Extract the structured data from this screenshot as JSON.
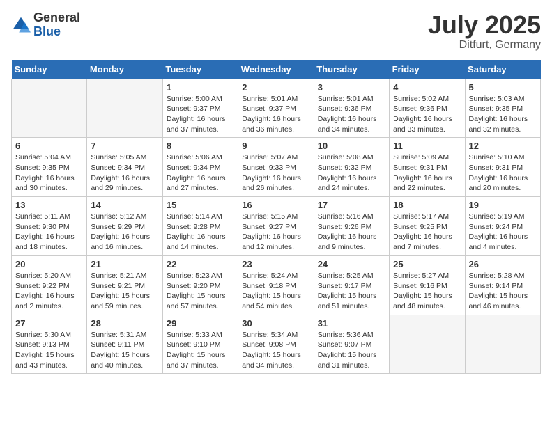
{
  "header": {
    "logo": {
      "general": "General",
      "blue": "Blue"
    },
    "title": "July 2025",
    "subtitle": "Ditfurt, Germany"
  },
  "calendar": {
    "weekdays": [
      "Sunday",
      "Monday",
      "Tuesday",
      "Wednesday",
      "Thursday",
      "Friday",
      "Saturday"
    ],
    "weeks": [
      [
        {
          "day": null,
          "info": null
        },
        {
          "day": null,
          "info": null
        },
        {
          "day": "1",
          "info": "Sunrise: 5:00 AM\nSunset: 9:37 PM\nDaylight: 16 hours\nand 37 minutes."
        },
        {
          "day": "2",
          "info": "Sunrise: 5:01 AM\nSunset: 9:37 PM\nDaylight: 16 hours\nand 36 minutes."
        },
        {
          "day": "3",
          "info": "Sunrise: 5:01 AM\nSunset: 9:36 PM\nDaylight: 16 hours\nand 34 minutes."
        },
        {
          "day": "4",
          "info": "Sunrise: 5:02 AM\nSunset: 9:36 PM\nDaylight: 16 hours\nand 33 minutes."
        },
        {
          "day": "5",
          "info": "Sunrise: 5:03 AM\nSunset: 9:35 PM\nDaylight: 16 hours\nand 32 minutes."
        }
      ],
      [
        {
          "day": "6",
          "info": "Sunrise: 5:04 AM\nSunset: 9:35 PM\nDaylight: 16 hours\nand 30 minutes."
        },
        {
          "day": "7",
          "info": "Sunrise: 5:05 AM\nSunset: 9:34 PM\nDaylight: 16 hours\nand 29 minutes."
        },
        {
          "day": "8",
          "info": "Sunrise: 5:06 AM\nSunset: 9:34 PM\nDaylight: 16 hours\nand 27 minutes."
        },
        {
          "day": "9",
          "info": "Sunrise: 5:07 AM\nSunset: 9:33 PM\nDaylight: 16 hours\nand 26 minutes."
        },
        {
          "day": "10",
          "info": "Sunrise: 5:08 AM\nSunset: 9:32 PM\nDaylight: 16 hours\nand 24 minutes."
        },
        {
          "day": "11",
          "info": "Sunrise: 5:09 AM\nSunset: 9:31 PM\nDaylight: 16 hours\nand 22 minutes."
        },
        {
          "day": "12",
          "info": "Sunrise: 5:10 AM\nSunset: 9:31 PM\nDaylight: 16 hours\nand 20 minutes."
        }
      ],
      [
        {
          "day": "13",
          "info": "Sunrise: 5:11 AM\nSunset: 9:30 PM\nDaylight: 16 hours\nand 18 minutes."
        },
        {
          "day": "14",
          "info": "Sunrise: 5:12 AM\nSunset: 9:29 PM\nDaylight: 16 hours\nand 16 minutes."
        },
        {
          "day": "15",
          "info": "Sunrise: 5:14 AM\nSunset: 9:28 PM\nDaylight: 16 hours\nand 14 minutes."
        },
        {
          "day": "16",
          "info": "Sunrise: 5:15 AM\nSunset: 9:27 PM\nDaylight: 16 hours\nand 12 minutes."
        },
        {
          "day": "17",
          "info": "Sunrise: 5:16 AM\nSunset: 9:26 PM\nDaylight: 16 hours\nand 9 minutes."
        },
        {
          "day": "18",
          "info": "Sunrise: 5:17 AM\nSunset: 9:25 PM\nDaylight: 16 hours\nand 7 minutes."
        },
        {
          "day": "19",
          "info": "Sunrise: 5:19 AM\nSunset: 9:24 PM\nDaylight: 16 hours\nand 4 minutes."
        }
      ],
      [
        {
          "day": "20",
          "info": "Sunrise: 5:20 AM\nSunset: 9:22 PM\nDaylight: 16 hours\nand 2 minutes."
        },
        {
          "day": "21",
          "info": "Sunrise: 5:21 AM\nSunset: 9:21 PM\nDaylight: 15 hours\nand 59 minutes."
        },
        {
          "day": "22",
          "info": "Sunrise: 5:23 AM\nSunset: 9:20 PM\nDaylight: 15 hours\nand 57 minutes."
        },
        {
          "day": "23",
          "info": "Sunrise: 5:24 AM\nSunset: 9:18 PM\nDaylight: 15 hours\nand 54 minutes."
        },
        {
          "day": "24",
          "info": "Sunrise: 5:25 AM\nSunset: 9:17 PM\nDaylight: 15 hours\nand 51 minutes."
        },
        {
          "day": "25",
          "info": "Sunrise: 5:27 AM\nSunset: 9:16 PM\nDaylight: 15 hours\nand 48 minutes."
        },
        {
          "day": "26",
          "info": "Sunrise: 5:28 AM\nSunset: 9:14 PM\nDaylight: 15 hours\nand 46 minutes."
        }
      ],
      [
        {
          "day": "27",
          "info": "Sunrise: 5:30 AM\nSunset: 9:13 PM\nDaylight: 15 hours\nand 43 minutes."
        },
        {
          "day": "28",
          "info": "Sunrise: 5:31 AM\nSunset: 9:11 PM\nDaylight: 15 hours\nand 40 minutes."
        },
        {
          "day": "29",
          "info": "Sunrise: 5:33 AM\nSunset: 9:10 PM\nDaylight: 15 hours\nand 37 minutes."
        },
        {
          "day": "30",
          "info": "Sunrise: 5:34 AM\nSunset: 9:08 PM\nDaylight: 15 hours\nand 34 minutes."
        },
        {
          "day": "31",
          "info": "Sunrise: 5:36 AM\nSunset: 9:07 PM\nDaylight: 15 hours\nand 31 minutes."
        },
        {
          "day": null,
          "info": null
        },
        {
          "day": null,
          "info": null
        }
      ]
    ]
  }
}
